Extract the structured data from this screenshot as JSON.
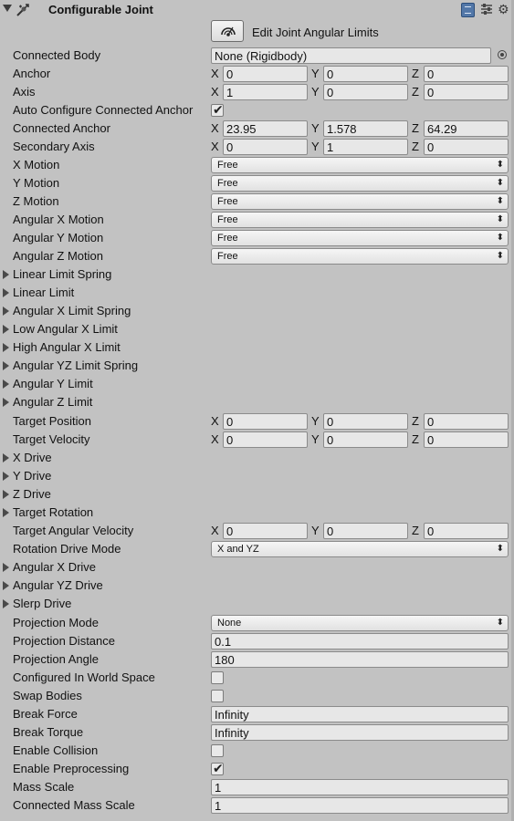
{
  "component": {
    "title": "Configurable Joint",
    "icons": {
      "foldout": "foldout-open-icon",
      "component": "joint-icon",
      "help": "help-book-icon",
      "presets": "presets-icon",
      "settings": "gear-icon"
    }
  },
  "edit_button": {
    "label": "Edit Joint Angular Limits",
    "icon": "edit-angular-limits-icon"
  },
  "fields": {
    "connected_body": {
      "label": "Connected Body",
      "value": "None (Rigidbody)"
    },
    "anchor": {
      "label": "Anchor",
      "x": "0",
      "y": "0",
      "z": "0"
    },
    "axis": {
      "label": "Axis",
      "x": "1",
      "y": "0",
      "z": "0"
    },
    "auto_configure": {
      "label": "Auto Configure Connected Anchor",
      "checked": true
    },
    "connected_anchor": {
      "label": "Connected Anchor",
      "x": "23.95",
      "y": "1.578",
      "z": "64.29"
    },
    "secondary_axis": {
      "label": "Secondary Axis",
      "x": "0",
      "y": "1",
      "z": "0"
    },
    "x_motion": {
      "label": "X Motion",
      "value": "Free"
    },
    "y_motion": {
      "label": "Y Motion",
      "value": "Free"
    },
    "z_motion": {
      "label": "Z Motion",
      "value": "Free"
    },
    "angular_x_motion": {
      "label": "Angular X Motion",
      "value": "Free"
    },
    "angular_y_motion": {
      "label": "Angular Y Motion",
      "value": "Free"
    },
    "angular_z_motion": {
      "label": "Angular Z Motion",
      "value": "Free"
    },
    "linear_limit_spring": {
      "label": "Linear Limit Spring"
    },
    "linear_limit": {
      "label": "Linear Limit"
    },
    "angular_x_limit_spring": {
      "label": "Angular X Limit Spring"
    },
    "low_angular_x_limit": {
      "label": "Low Angular X Limit"
    },
    "high_angular_x_limit": {
      "label": "High Angular X Limit"
    },
    "angular_yz_limit_spring": {
      "label": "Angular YZ Limit Spring"
    },
    "angular_y_limit": {
      "label": "Angular Y Limit"
    },
    "angular_z_limit": {
      "label": "Angular Z Limit"
    },
    "target_position": {
      "label": "Target Position",
      "x": "0",
      "y": "0",
      "z": "0"
    },
    "target_velocity": {
      "label": "Target Velocity",
      "x": "0",
      "y": "0",
      "z": "0"
    },
    "x_drive": {
      "label": "X Drive"
    },
    "y_drive": {
      "label": "Y Drive"
    },
    "z_drive": {
      "label": "Z Drive"
    },
    "target_rotation": {
      "label": "Target Rotation"
    },
    "target_angular_velocity": {
      "label": "Target Angular Velocity",
      "x": "0",
      "y": "0",
      "z": "0"
    },
    "rotation_drive_mode": {
      "label": "Rotation Drive Mode",
      "value": "X and YZ"
    },
    "angular_x_drive": {
      "label": "Angular X Drive"
    },
    "angular_yz_drive": {
      "label": "Angular YZ Drive"
    },
    "slerp_drive": {
      "label": "Slerp Drive"
    },
    "projection_mode": {
      "label": "Projection Mode",
      "value": "None"
    },
    "projection_distance": {
      "label": "Projection Distance",
      "value": "0.1"
    },
    "projection_angle": {
      "label": "Projection Angle",
      "value": "180"
    },
    "configured_in_world_space": {
      "label": "Configured In World Space",
      "checked": false
    },
    "swap_bodies": {
      "label": "Swap Bodies",
      "checked": false
    },
    "break_force": {
      "label": "Break Force",
      "value": "Infinity"
    },
    "break_torque": {
      "label": "Break Torque",
      "value": "Infinity"
    },
    "enable_collision": {
      "label": "Enable Collision",
      "checked": false
    },
    "enable_preprocessing": {
      "label": "Enable Preprocessing",
      "checked": true
    },
    "mass_scale": {
      "label": "Mass Scale",
      "value": "1"
    },
    "connected_mass_scale": {
      "label": "Connected Mass Scale",
      "value": "1"
    }
  },
  "axis_labels": {
    "x": "X",
    "y": "Y",
    "z": "Z"
  },
  "glyphs": {
    "caret": "⬍",
    "check": "✔"
  }
}
